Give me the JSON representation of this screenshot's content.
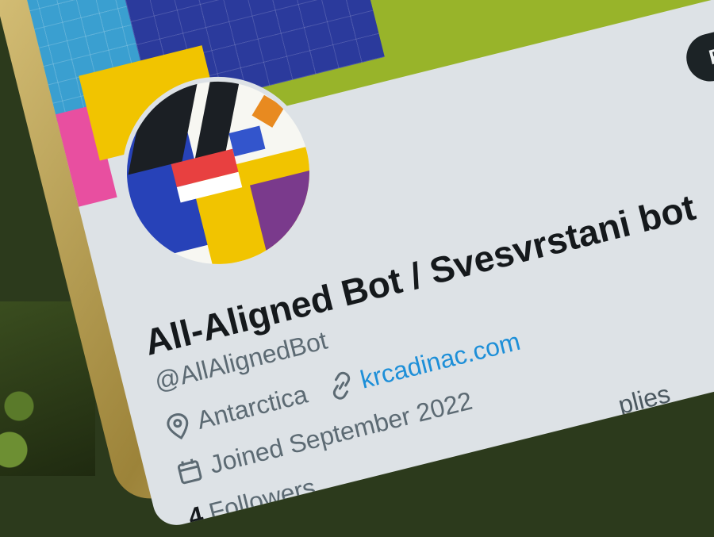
{
  "profile": {
    "display_name": "All-Aligned Bot / Svesvrstani bot",
    "handle": "@AllAlignedBot",
    "location": "Antarctica",
    "website": "krcadinac.com",
    "joined": "Joined September 2022",
    "followers_count": "4",
    "followers_label": "Followers"
  },
  "actions": {
    "follow_label": "Follow"
  },
  "tabs": {
    "replies_partial": "plies"
  },
  "colors": {
    "follow_bg": "#1c2326",
    "link": "#1d8fd8",
    "banner_green": "#98b42a",
    "banner_navy": "#2b3a9c",
    "banner_cyan": "#3a9fd0"
  },
  "icons": {
    "location": "map-pin-icon",
    "website": "link-icon",
    "joined": "calendar-icon",
    "banner_star": "star-icon"
  }
}
